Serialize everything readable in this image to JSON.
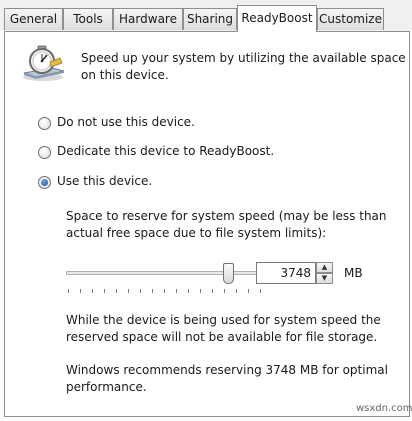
{
  "tabs": [
    {
      "label": "General"
    },
    {
      "label": "Tools"
    },
    {
      "label": "Hardware"
    },
    {
      "label": "Sharing"
    },
    {
      "label": "ReadyBoost"
    },
    {
      "label": "Customize"
    }
  ],
  "active_tab": "ReadyBoost",
  "header": {
    "icon": "readyboost-stopwatch-icon",
    "line1": "Speed up your system by utilizing the available space",
    "line2": "on this device."
  },
  "options": [
    {
      "label": "Do not use this device.",
      "selected": false
    },
    {
      "label": "Dedicate this device to ReadyBoost.",
      "selected": false
    },
    {
      "label": "Use this device.",
      "selected": true
    }
  ],
  "reserve": {
    "label_line1": "Space to reserve for system speed (may be less than",
    "label_line2": "actual free space due to file system limits):",
    "value": "3748",
    "unit": "MB",
    "slider_level": 0.83
  },
  "notes": {
    "storage_line1": "While the device is being used for system speed the",
    "storage_line2": "reserved space will not be available for file storage.",
    "recommend_line1": "Windows recommends reserving 3748 MB for optimal",
    "recommend_line2": "performance."
  },
  "watermark": "wsxdn.com",
  "colors": {
    "accent": "#1a4f9a",
    "border": "#8e8f8f"
  }
}
